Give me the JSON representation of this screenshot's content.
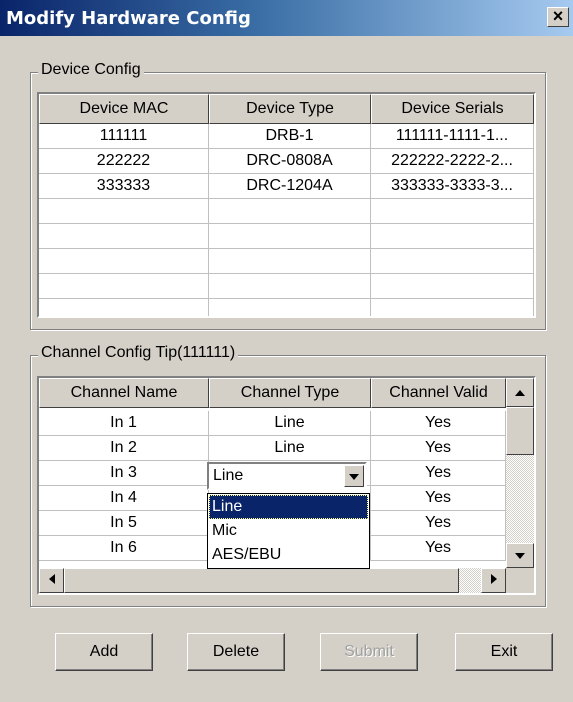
{
  "window": {
    "title": "Modify Hardware Config",
    "close_label": "×"
  },
  "device_config": {
    "label": "Device Config",
    "columns": [
      "Device MAC",
      "Device Type",
      "Device Serials"
    ],
    "rows": [
      [
        "111111",
        "DRB-1",
        "111111-1111-1..."
      ],
      [
        "222222",
        "DRC-0808A",
        "222222-2222-2..."
      ],
      [
        "333333",
        "DRC-1204A",
        "333333-3333-3..."
      ]
    ]
  },
  "channel_config": {
    "label": "Channel Config Tip(111111)",
    "columns": [
      "Channel Name",
      "Channel Type",
      "Channel Valid"
    ],
    "rows": [
      [
        "In 1",
        "Line",
        "Yes"
      ],
      [
        "In 2",
        "Line",
        "Yes"
      ],
      [
        "In 3",
        "",
        "Yes"
      ],
      [
        "In 4",
        "",
        "Yes"
      ],
      [
        "In 5",
        "",
        "Yes"
      ],
      [
        "In 6",
        "",
        "Yes"
      ]
    ],
    "combo_value": "Line",
    "dropdown_options": [
      "Line",
      "Mic",
      "AES/EBU"
    ],
    "selected_option": "Line"
  },
  "buttons": {
    "add": "Add",
    "delete": "Delete",
    "submit": "Submit",
    "exit": "Exit"
  },
  "icons": {
    "scroll_up": "up-arrow-icon",
    "scroll_down": "down-arrow-icon",
    "scroll_left": "left-arrow-icon",
    "scroll_right": "right-arrow-icon",
    "combo_arrow": "chevron-down-icon",
    "close": "close-icon"
  },
  "colors": {
    "titlebar_start": "#0a246a",
    "titlebar_end": "#a6caf0",
    "selection": "#0a246a",
    "face": "#d4d0c8"
  }
}
